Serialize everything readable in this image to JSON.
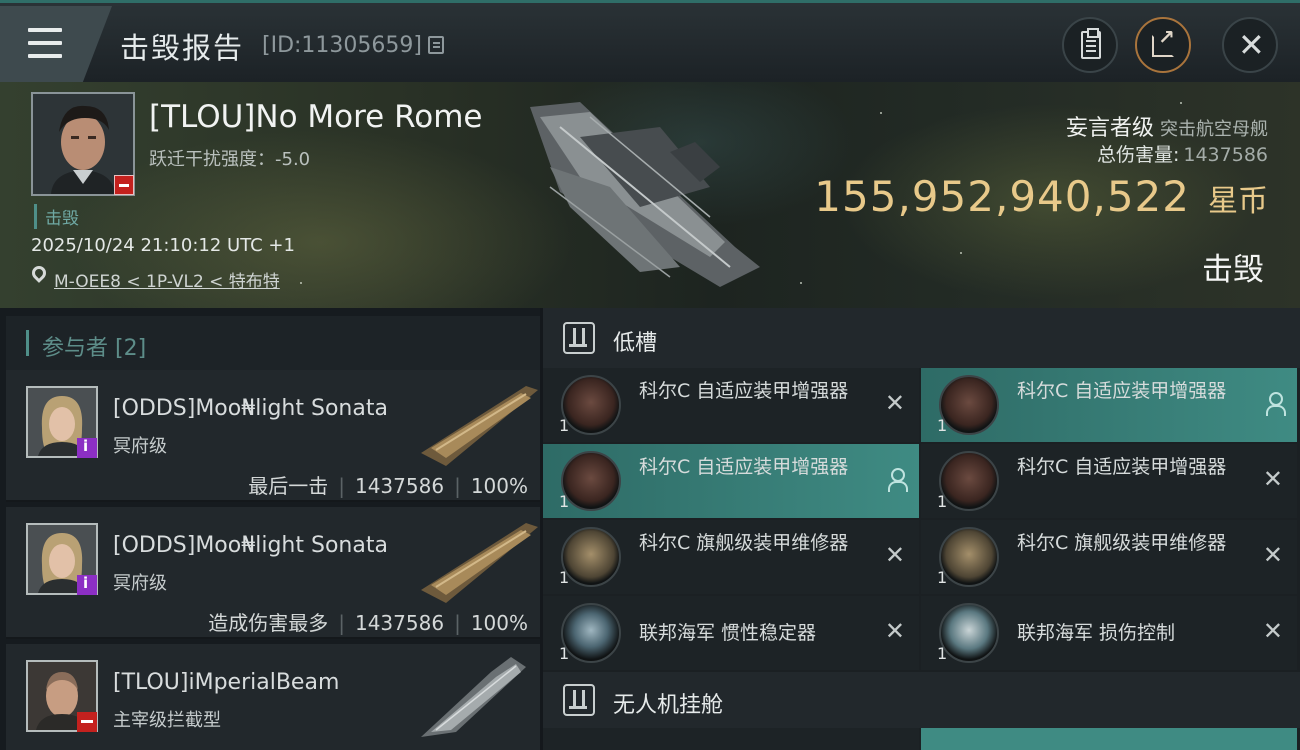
{
  "header": {
    "title": "击毁报告",
    "report_id": "[ID:11305659]"
  },
  "victim": {
    "name": "[TLOU]No More Rome",
    "warp_scramble": "跃迁干扰强度：-5.0",
    "kill_tag": "击毁",
    "timestamp": "2025/10/24 21:10:12 UTC +1",
    "location": "M-OEE8 < 1P-VL2 < 特布特",
    "ship_class": "妄言者级",
    "ship_type": "突击航空母舰",
    "total_damage_label": "总伤害量:",
    "total_damage": "1437586",
    "isk_value": "155,952,940,522",
    "isk_unit": "星币",
    "result": "击毁"
  },
  "participants": {
    "header": "参与者 [2]",
    "rows": [
      {
        "name": "[ODDS]Moo₦light Sonata",
        "ship": "冥府级",
        "role": "最后一击",
        "damage": "1437586",
        "percent": "100%"
      },
      {
        "name": "[ODDS]Moo₦light Sonata",
        "ship": "冥府级",
        "role": "造成伤害最多",
        "damage": "1437586",
        "percent": "100%"
      },
      {
        "name": "[TLOU]iMperialBeam",
        "ship": "主宰级拦截型"
      }
    ]
  },
  "modules": {
    "low_slots_title": "低槽",
    "drone_bay_title": "无人机挂舱",
    "items": [
      {
        "name": "科尔C 自适应装甲增强器",
        "qty": "1"
      },
      {
        "name": "科尔C 自适应装甲增强器",
        "qty": "1"
      },
      {
        "name": "科尔C 自适应装甲增强器",
        "qty": "1"
      },
      {
        "name": "科尔C 自适应装甲增强器",
        "qty": "1"
      },
      {
        "name": "科尔C 旗舰级装甲维修器",
        "qty": "1"
      },
      {
        "name": "科尔C 旗舰级装甲维修器",
        "qty": "1"
      },
      {
        "name": "联邦海军 惯性稳定器",
        "qty": "1"
      },
      {
        "name": "联邦海军 损伤控制",
        "qty": "1"
      }
    ]
  },
  "colors": {
    "accent_teal": "#3f8b83",
    "isk_gold": "#e8c98a",
    "alert_red": "#c4211e",
    "role_purple": "#8c2fc4"
  }
}
